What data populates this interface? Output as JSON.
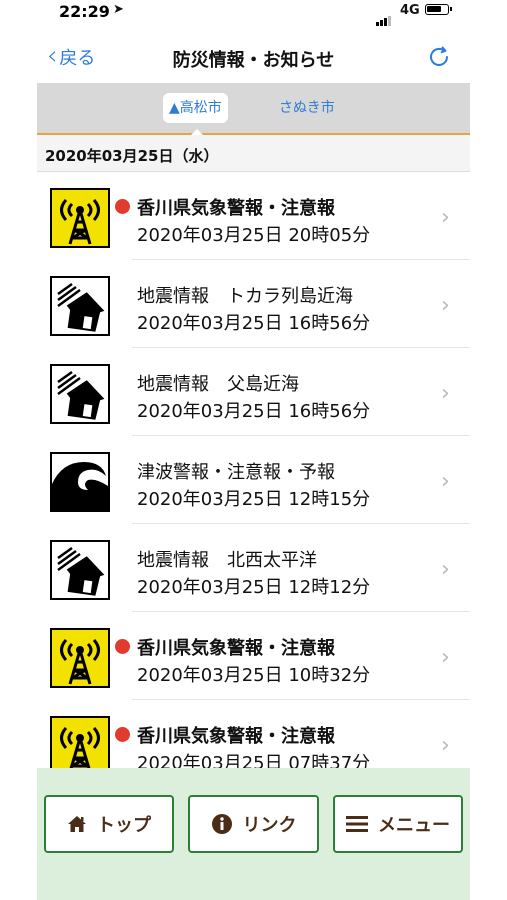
{
  "status": {
    "time": "22:29",
    "network": "4G"
  },
  "nav": {
    "back_label": "戻る",
    "title": "防災情報・お知らせ"
  },
  "segments": [
    {
      "label": "▲高松市",
      "selected": true
    },
    {
      "label": "さぬき市",
      "selected": false
    }
  ],
  "section_date": "2020年03月25日（水）",
  "items": [
    {
      "icon": "weather-alert-tower-icon",
      "unread": true,
      "title": "香川県気象警報・注意報",
      "time": "2020年03月25日 20時05分"
    },
    {
      "icon": "earthquake-house-icon",
      "unread": false,
      "title": "地震情報　トカラ列島近海",
      "time": "2020年03月25日 16時56分"
    },
    {
      "icon": "earthquake-house-icon",
      "unread": false,
      "title": "地震情報　父島近海",
      "time": "2020年03月25日 16時56分"
    },
    {
      "icon": "tsunami-wave-icon",
      "unread": false,
      "title": "津波警報・注意報・予報",
      "time": "2020年03月25日 12時15分"
    },
    {
      "icon": "earthquake-house-icon",
      "unread": false,
      "title": "地震情報　北西太平洋",
      "time": "2020年03月25日 12時12分"
    },
    {
      "icon": "weather-alert-tower-icon",
      "unread": true,
      "title": "香川県気象警報・注意報",
      "time": "2020年03月25日 10時32分"
    },
    {
      "icon": "weather-alert-tower-icon",
      "unread": true,
      "title": "香川県気象警報・注意報",
      "time": "2020年03月25日 07時37分"
    }
  ],
  "bottom_nav": {
    "top_label": "トップ",
    "link_label": "リンク",
    "menu_label": "メニュー"
  },
  "colors": {
    "accent_blue": "#2f7bd8",
    "unread_dot": "#e23a2c",
    "warning_yellow": "#f3e200",
    "button_border": "#2d7f37",
    "bottom_bg": "#dcefdc",
    "segment_underline": "#e3a646"
  }
}
